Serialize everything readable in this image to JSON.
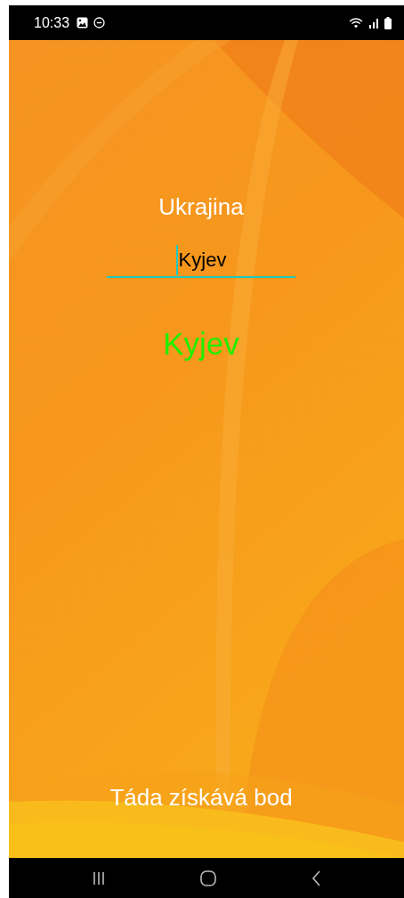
{
  "status_bar": {
    "time": "10:33"
  },
  "question": {
    "title": "Ukrajina"
  },
  "answer_field": {
    "value": "Kyjev",
    "focused": true
  },
  "result": {
    "text": "Kyjev",
    "correct": true
  },
  "score_message": "Táda získává bod"
}
